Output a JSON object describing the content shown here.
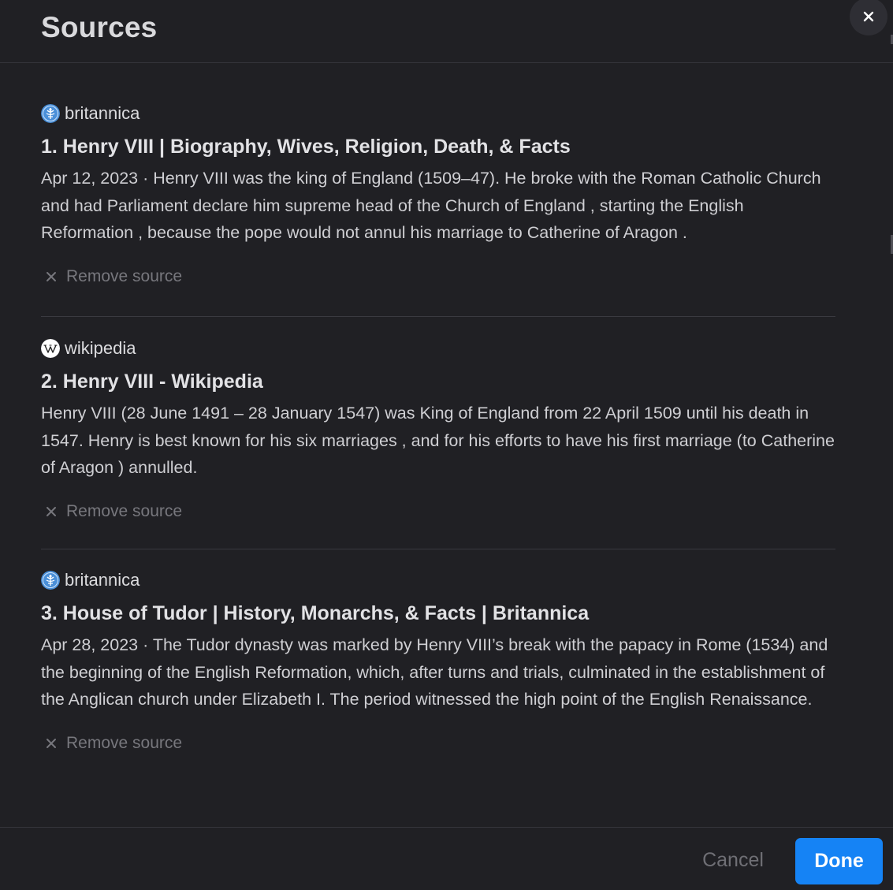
{
  "modal": {
    "title": "Sources",
    "close_icon": "close-icon"
  },
  "sources": [
    {
      "domain": "britannica",
      "favicon": "britannica-icon",
      "title": "1. Henry VIII | Biography, Wives, Religion, Death, & Facts",
      "snippet": "Apr 12, 2023 · Henry VIII was the king of England (1509–47). He broke with the Roman Catholic Church and had Parliament declare him supreme head of the Church of England , starting the English Reformation , because the pope would not annul his marriage to Catherine of Aragon .",
      "remove_label": "Remove source"
    },
    {
      "domain": "wikipedia",
      "favicon": "wikipedia-icon",
      "title": "2. Henry VIII - Wikipedia",
      "snippet": "Henry VIII (28 June 1491 – 28 January 1547) was King of England from 22 April 1509 until his death in 1547. Henry is best known for his six marriages , and for his efforts to have his first marriage (to Catherine of Aragon ) annulled.",
      "remove_label": "Remove source"
    },
    {
      "domain": "britannica",
      "favicon": "britannica-icon",
      "title": "3. House of Tudor | History, Monarchs, & Facts | Britannica",
      "snippet": "Apr 28, 2023 · The Tudor dynasty was marked by Henry VIII’s break with the papacy in Rome (1534) and the beginning of the English Reformation, which, after turns and trials, culminated in the establishment of the Anglican church under Elizabeth I. The period witnessed the high point of the English Renaissance.",
      "remove_label": "Remove source"
    }
  ],
  "footer": {
    "cancel_label": "Cancel",
    "done_label": "Done"
  },
  "colors": {
    "background": "#202024",
    "accent": "#1583f5",
    "muted_text": "#77777d",
    "divider": "#3a3a40"
  }
}
